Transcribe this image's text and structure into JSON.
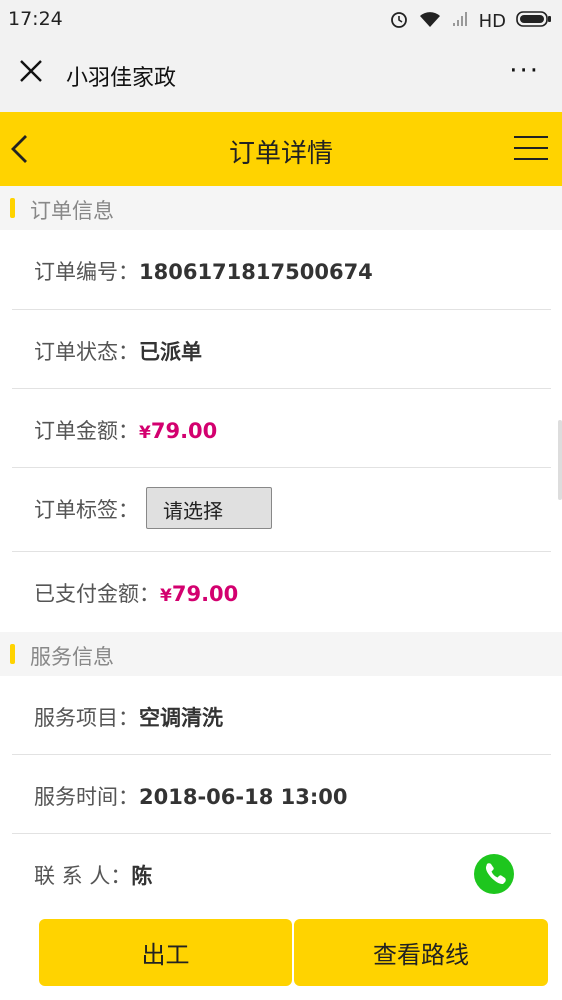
{
  "status_bar": {
    "time": "17:24",
    "network": "HD",
    "icons": [
      "alarm-icon",
      "wifi-icon",
      "signal-icon",
      "battery-icon"
    ]
  },
  "nav": {
    "title": "小羽佳家政",
    "close_icon": "close-icon",
    "more_label": "···"
  },
  "header": {
    "title": "订单详情",
    "back_icon": "chevron-left-icon",
    "menu_icon": "hamburger-icon"
  },
  "order_section": {
    "title": "订单信息",
    "order_no_label": "订单编号：",
    "order_no": "1806171817500674",
    "status_label": "订单状态：",
    "status": "已派单",
    "amount_label": "订单金额：",
    "amount_currency": "¥",
    "amount": "79.00",
    "tag_label": "订单标签：",
    "tag_select": "请选择",
    "paid_label": "已支付金额：",
    "paid_currency": "¥",
    "paid": "79.00"
  },
  "service_section": {
    "title": "服务信息",
    "item_label": "服务项目：",
    "item": "空调清洗",
    "time_label": "服务时间：",
    "time": "2018-06-18 13:00",
    "contact_label": "联 系 人：",
    "contact": "陈"
  },
  "actions": {
    "start_label": "出工",
    "route_label": "查看路线"
  },
  "colors": {
    "accent": "#ffd300",
    "money": "#d3006f",
    "call": "#1ec61e"
  }
}
